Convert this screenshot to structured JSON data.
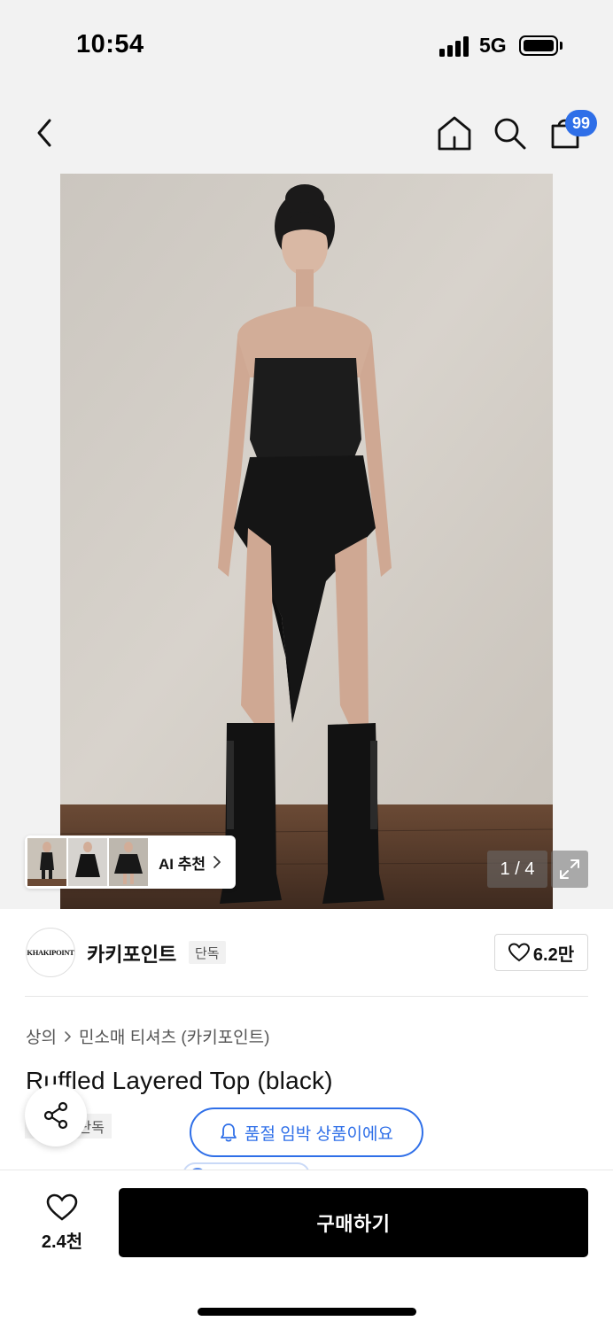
{
  "status_bar": {
    "time": "10:54",
    "network": "5G"
  },
  "header": {
    "back_icon": "chevron-left-icon",
    "home_icon": "home-icon",
    "search_icon": "search-icon",
    "cart_icon": "shopping-bag-icon",
    "cart_badge": "99"
  },
  "gallery": {
    "ai_recommend_label": "AI 추천",
    "counter": "1 / 4",
    "expand_icon": "expand-icon"
  },
  "brand": {
    "logo_text": "KHAKIPOINT",
    "name": "카키포인트",
    "tag": "단독",
    "likes": "6.2만"
  },
  "product": {
    "breadcrumb": [
      "상의",
      "민소매 티셔츠 (카키포인트)"
    ],
    "title": "Ruffled Layered Top (black)",
    "exclusive_tag": "단독",
    "stock_notice": "품절 임박 상품이에요"
  },
  "bottom": {
    "like_count": "2.4천",
    "buy_label": "구매하기"
  },
  "colors": {
    "accent": "#2f6fe8",
    "buy_button": "#000000",
    "background": "#f2f2f2"
  }
}
